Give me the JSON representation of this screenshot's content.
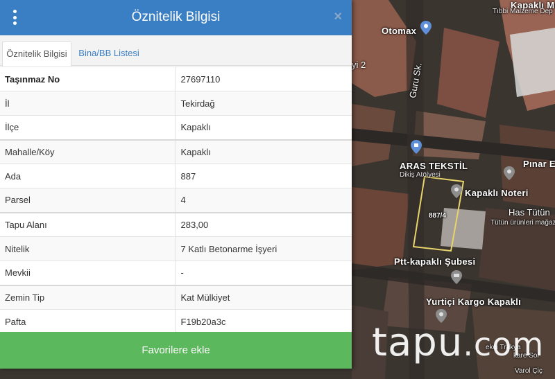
{
  "panel": {
    "title": "Öznitelik Bilgisi",
    "menu_icon": "vertical-dots-icon",
    "close_icon": "close-icon",
    "close_glyph": "×",
    "tabs": [
      {
        "label": "Öznitelik Bilgisi",
        "active": true
      },
      {
        "label": "Bina/BB Listesi",
        "active": false
      }
    ],
    "rows": [
      {
        "key": "Taşınmaz No",
        "value": "27697110"
      },
      {
        "key": "İl",
        "value": "Tekirdağ"
      },
      {
        "key": "İlçe",
        "value": "Kapaklı"
      },
      {
        "key": "Mahalle/Köy",
        "value": "Kapaklı"
      },
      {
        "key": "Ada",
        "value": "887"
      },
      {
        "key": "Parsel",
        "value": "4"
      },
      {
        "key": "Tapu Alanı",
        "value": "283,00"
      },
      {
        "key": "Nitelik",
        "value": "7 Katlı Betonarme İşyeri"
      },
      {
        "key": "Mevkii",
        "value": "-"
      },
      {
        "key": "Zemin Tip",
        "value": "Kat Mülkiyet"
      },
      {
        "key": "Pafta",
        "value": "F19b20a3c"
      }
    ],
    "favorite_button": "Favorilere ekle",
    "header_color": "#3a7fc4",
    "button_color": "#5cb85c"
  },
  "map": {
    "labels": {
      "kapakli_med": "Kapaklı Med",
      "tibbi": "Tıbbi Malzeme Dep",
      "otomax": "Otomax",
      "street_2": "yi 2",
      "guru": "Guru Sk.",
      "aras": "ARAS TEKSTİL",
      "dikis": "Dikiş Atölyesi",
      "pinar": "Pınar E",
      "noteri": "Kapaklı Noteri",
      "has": "Has Tütün",
      "tutun": "Tütün ürünleri mağaza",
      "parcel": "887/4",
      "ptt": "Ptt-kapaklı Şubesi",
      "yurtici": "Yurtiçi Kargo Kapaklı",
      "trakya": "ekçi Trakya",
      "varol": "Varol Çiç",
      "vakar": "kare Sol"
    },
    "watermark": {
      "main": "tapu",
      "suffix": ".com"
    }
  }
}
